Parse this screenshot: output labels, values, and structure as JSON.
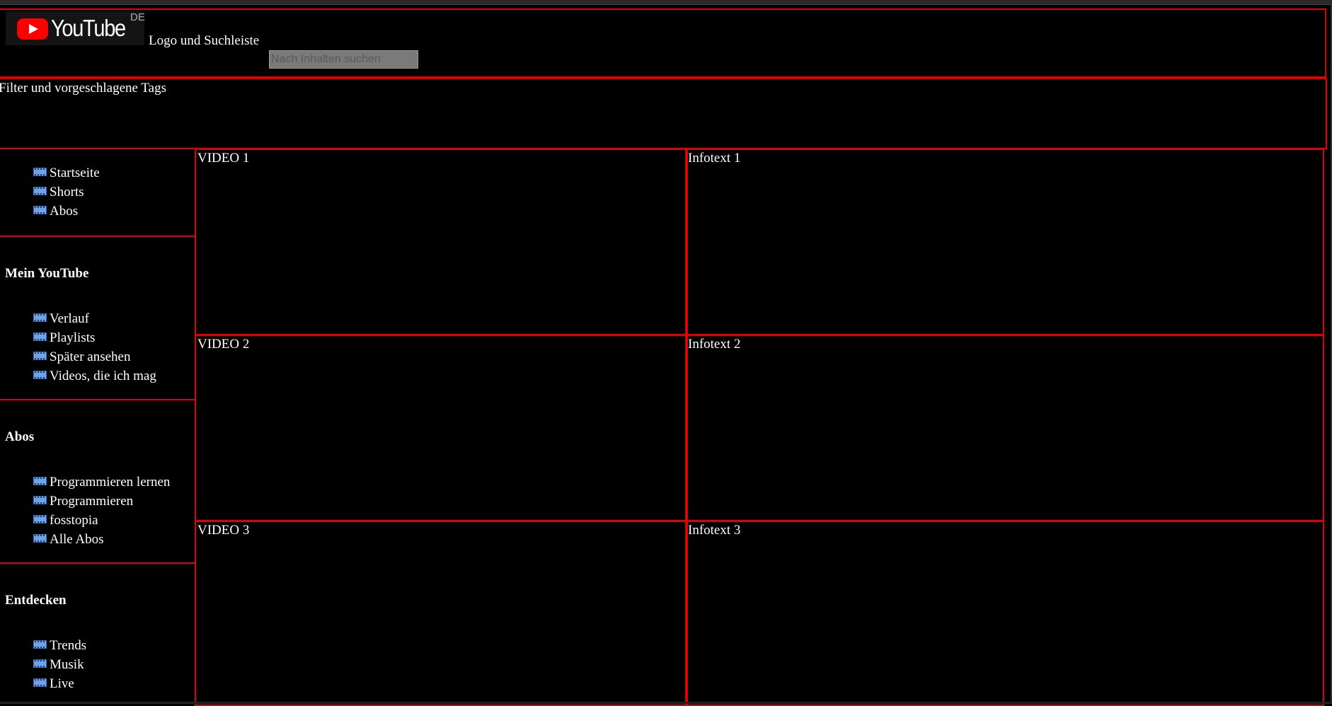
{
  "header": {
    "logo_text": "YouTube",
    "region": "DE",
    "label": "Logo und Suchleiste",
    "search_placeholder": "Nach Inhalten suchen"
  },
  "filter": {
    "label": "Filter und vorgeschlagene Tags"
  },
  "sidebar": {
    "main_items": [
      "Startseite",
      "Shorts",
      "Abos"
    ],
    "sections": [
      {
        "heading": "Mein YouTube",
        "items": [
          "Verlauf",
          "Playlists",
          "Später ansehen",
          "Videos, die ich mag"
        ]
      },
      {
        "heading": "Abos",
        "items": [
          "Programmieren lernen",
          "Programmieren",
          "fosstopia",
          "Alle Abos"
        ]
      },
      {
        "heading": "Entdecken",
        "items": [
          "Trends",
          "Musik",
          "Live"
        ]
      }
    ]
  },
  "videos": [
    {
      "video": "VIDEO 1",
      "info": "Infotext 1"
    },
    {
      "video": "VIDEO 2",
      "info": "Infotext 2"
    },
    {
      "video": "VIDEO 3",
      "info": "Infotext 3"
    }
  ],
  "colors": {
    "border": "#e00000",
    "background": "#000000",
    "brand_red": "#ff0000"
  },
  "icons": {
    "sidebar_item": "film-icon"
  }
}
